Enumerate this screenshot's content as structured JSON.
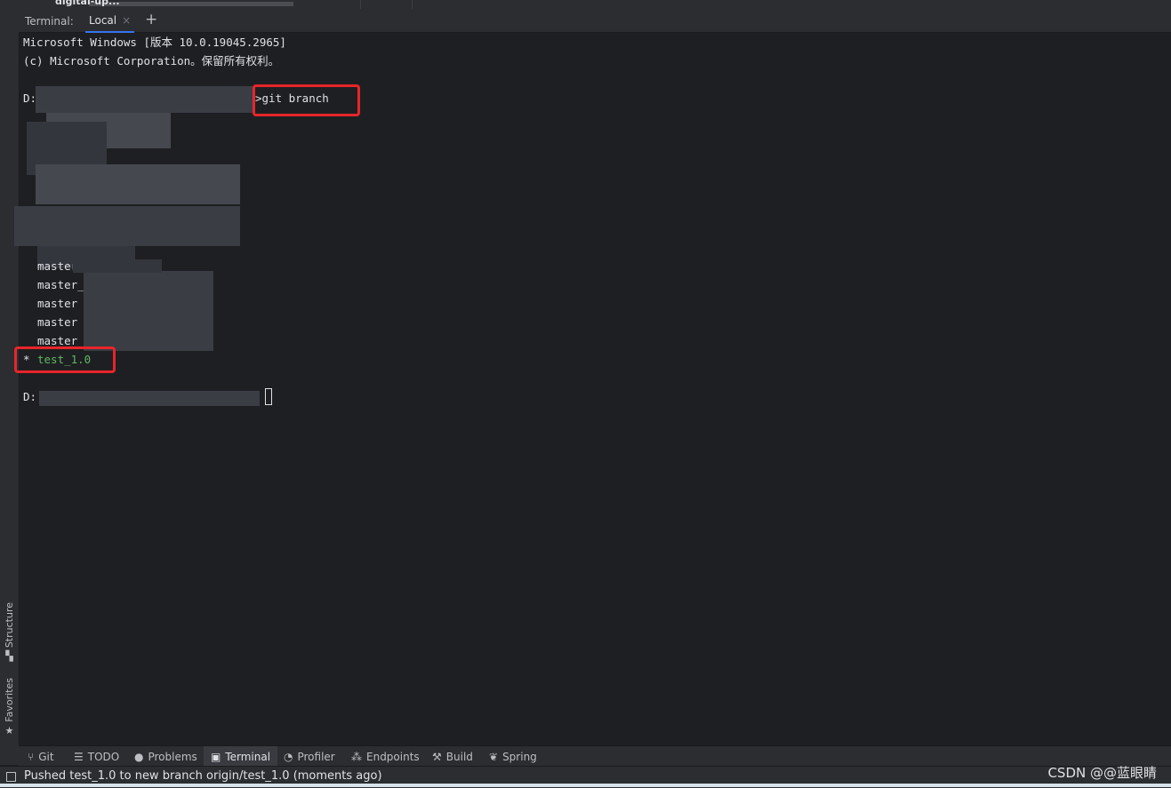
{
  "top_strip": {
    "project_crumb": "digital-up..."
  },
  "left_bar": {
    "tabs": [
      {
        "label": "Structure",
        "icon": "structure-icon"
      },
      {
        "label": "Favorites",
        "icon": "star-icon"
      }
    ]
  },
  "terminal_tabs": {
    "label": "Terminal:",
    "active_tab": "Local",
    "close_glyph": "×",
    "add_glyph": "+"
  },
  "terminal": {
    "lines": [
      "Microsoft Windows [版本 10.0.19045.2965]",
      "(c) Microsoft Corporation。保留所有权利。",
      "D:",
      ">git branch",
      "master",
      "master_",
      "master",
      "master",
      "master_",
      "* ",
      "test_1.0",
      "D:"
    ],
    "current_branch_color": "#5fb75f",
    "highlight_color": "#e8252a"
  },
  "tool_windows": [
    {
      "label": "Git",
      "icon": "git-branch-icon"
    },
    {
      "label": "TODO",
      "icon": "list-icon"
    },
    {
      "label": "Problems",
      "icon": "problems-icon"
    },
    {
      "label": "Terminal",
      "icon": "terminal-icon",
      "active": true
    },
    {
      "label": "Profiler",
      "icon": "profiler-icon"
    },
    {
      "label": "Endpoints",
      "icon": "endpoints-icon"
    },
    {
      "label": "Build",
      "icon": "hammer-icon"
    },
    {
      "label": "Spring",
      "icon": "spring-leaf-icon"
    }
  ],
  "status": {
    "message": "Pushed test_1.0 to new branch origin/test_1.0 (moments ago)",
    "watermark": "CSDN @@蓝眼睛"
  }
}
